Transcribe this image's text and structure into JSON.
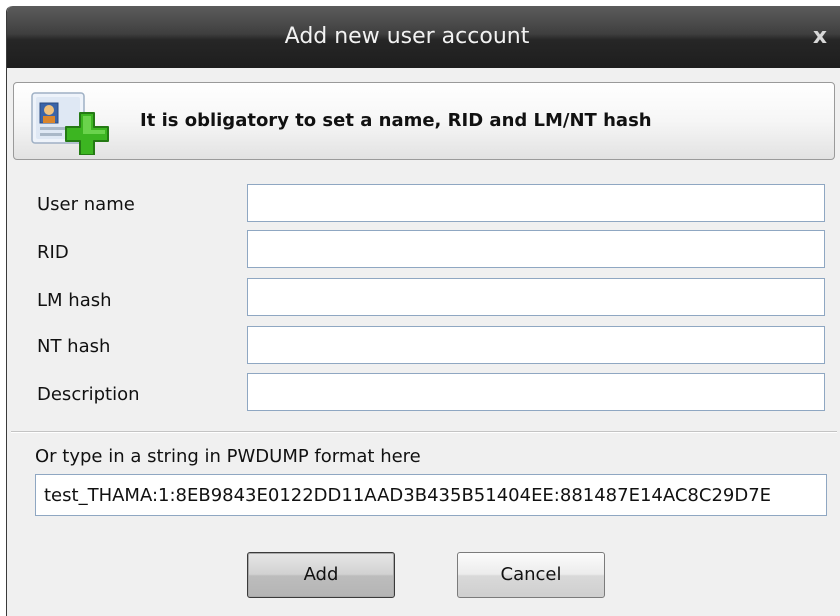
{
  "window": {
    "title": "Add new user account",
    "close_glyph": "x"
  },
  "banner": {
    "message": "It is obligatory to set a name, RID and LM/NT hash",
    "icon": "add-user-icon"
  },
  "form": {
    "user_name_label": "User name",
    "user_name_value": "",
    "rid_label": "RID",
    "rid_value": "",
    "lm_hash_label": "LM hash",
    "lm_hash_value": "",
    "nt_hash_label": "NT hash",
    "nt_hash_value": "",
    "description_label": "Description",
    "description_value": ""
  },
  "pwdump": {
    "label": "Or type in a string in PWDUMP format here",
    "value": "test_THAMA:1:8EB9843E0122DD11AAD3B435B51404EE:881487E14AC8C29D7E"
  },
  "buttons": {
    "add_label": "Add",
    "cancel_label": "Cancel"
  },
  "colors": {
    "titlebar": "#262626",
    "dialog_background": "#f0f0f0",
    "input_border": "#8fa7c2",
    "plus_green": "#3cb521"
  }
}
